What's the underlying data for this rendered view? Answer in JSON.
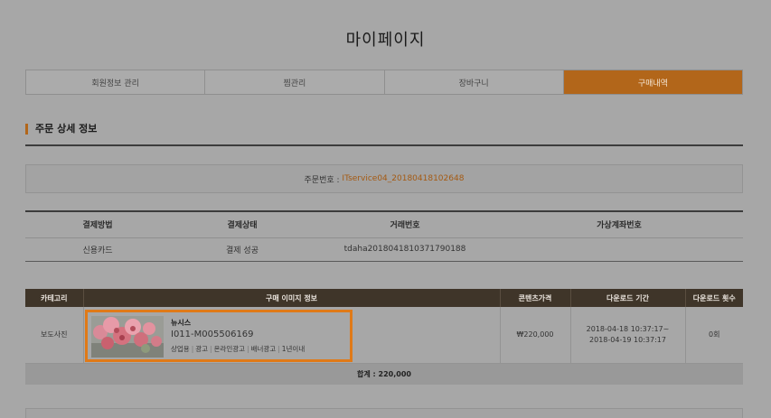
{
  "page": {
    "title": "마이페이지"
  },
  "tabs": [
    {
      "label": "회원정보 관리",
      "active": false
    },
    {
      "label": "찜관리",
      "active": false
    },
    {
      "label": "장바구니",
      "active": false
    },
    {
      "label": "구매내역",
      "active": true
    }
  ],
  "section": {
    "title": "주문 상세 정보"
  },
  "order": {
    "label": "주문번호 :",
    "number": "ITservice04_20180418102648"
  },
  "payment": {
    "headers": [
      "결제방법",
      "결제상태",
      "거래번호",
      "가상계좌번호"
    ],
    "row": [
      "신용카드",
      "결제 성공",
      "tdaha2018041810371790188",
      ""
    ]
  },
  "items": {
    "headers": [
      "카테고리",
      "구매 이미지 정보",
      "콘텐츠가격",
      "다운로드 기간",
      "다운로드 횟수"
    ],
    "row": {
      "category": "보도사진",
      "name": "뉴시스",
      "code": "I011-M005506169",
      "tags": [
        "상업용",
        "광고",
        "온라인광고",
        "배너광고",
        "1년이내"
      ],
      "price": "₩220,000",
      "period_start": "2018-04-18 10:37:17~",
      "period_end": "2018-04-19 10:37:17",
      "downloads": "0회"
    },
    "total": "합계 : 220,000"
  },
  "colors": {
    "accent": "#b2661a",
    "highlight_border": "#e07a18",
    "header_dark": "#3f3529"
  },
  "icons": {
    "thumbnail": "pink-flowers-photo"
  }
}
